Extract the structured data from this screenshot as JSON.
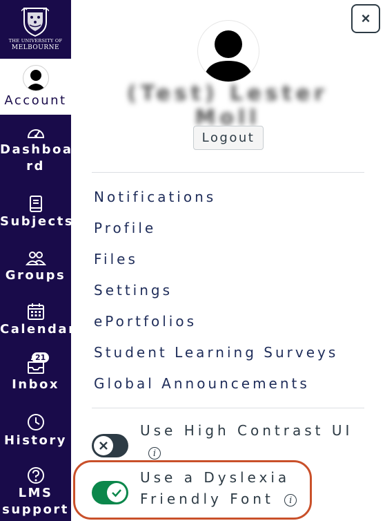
{
  "global_nav": {
    "logo": {
      "line1": "THE UNIVERSITY OF",
      "line2": "MELBOURNE"
    },
    "items": [
      {
        "label": "Account",
        "icon": "user-avatar-icon"
      },
      {
        "label_line1": "Dashboa",
        "label_line2": "rd",
        "icon": "dashboard-gauge-icon"
      },
      {
        "label": "Subjects",
        "icon": "book-icon"
      },
      {
        "label": "Groups",
        "icon": "groups-icon"
      },
      {
        "label": "Calendar",
        "icon": "calendar-icon"
      },
      {
        "label": "Inbox",
        "icon": "inbox-icon",
        "badge": "21"
      },
      {
        "label": "History",
        "icon": "clock-icon"
      },
      {
        "label_line1": "LMS",
        "label_line2": "support",
        "icon": "help-icon"
      }
    ],
    "bg_color": "#190b4a"
  },
  "tray": {
    "close_label": "×",
    "user_name": "(Test) Lester Moll",
    "logout_label": "Logout",
    "links": [
      "Notifications",
      "Profile",
      "Files",
      "Settings",
      "ePortfolios",
      "Student Learning Surveys",
      "Global Announcements"
    ],
    "options": [
      {
        "text": "Use High Contrast UI",
        "enabled": false
      },
      {
        "text_line1": "Use a Dyslexia",
        "text_line2": "Friendly Font",
        "enabled": true
      }
    ],
    "info_glyph": "i",
    "toggle_on_color": "#0b874b",
    "toggle_off_color": "#2d3b45",
    "highlight_color": "#c9502a"
  }
}
